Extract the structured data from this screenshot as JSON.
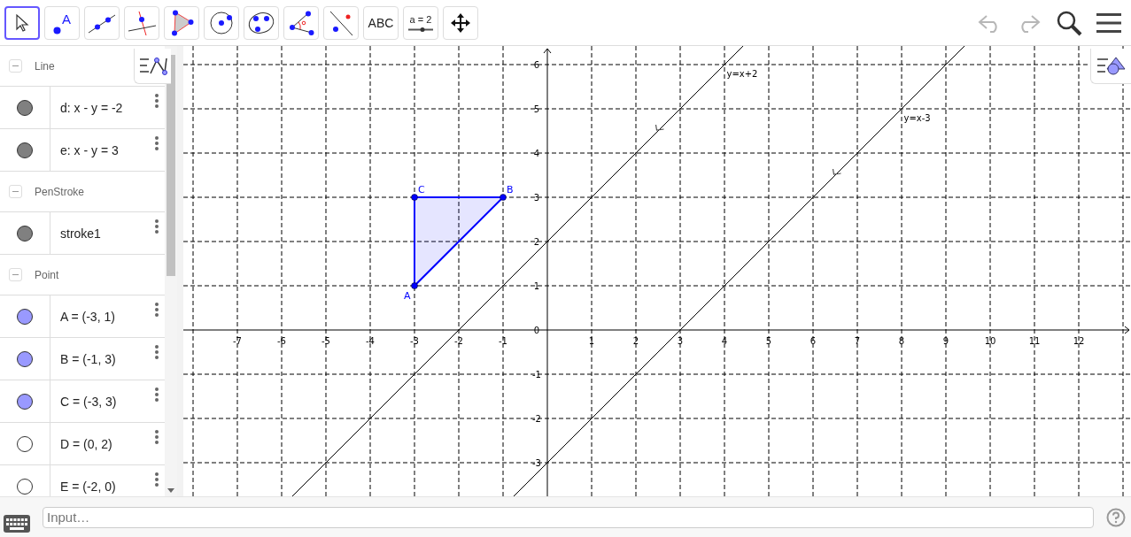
{
  "toolbar": {
    "tools": [
      {
        "kind": "move",
        "selected": true
      },
      {
        "kind": "point",
        "selected": false,
        "label": "A"
      },
      {
        "kind": "line",
        "selected": false
      },
      {
        "kind": "perpendicular",
        "selected": false
      },
      {
        "kind": "polygon",
        "selected": false
      },
      {
        "kind": "circle",
        "selected": false
      },
      {
        "kind": "conic",
        "selected": false
      },
      {
        "kind": "angle",
        "selected": false
      },
      {
        "kind": "reflect",
        "selected": false
      },
      {
        "kind": "text",
        "selected": false,
        "label": "ABC"
      },
      {
        "kind": "slider",
        "selected": false,
        "label": "a = 2"
      },
      {
        "kind": "pan",
        "selected": false
      }
    ],
    "actions": [
      {
        "kind": "undo",
        "disabled": true
      },
      {
        "kind": "redo",
        "disabled": true
      },
      {
        "kind": "search",
        "disabled": false
      },
      {
        "kind": "menu",
        "disabled": false
      }
    ]
  },
  "algebra": {
    "groups": [
      {
        "label": "Line",
        "expanded": true,
        "items": [
          {
            "text": "d: x - y = -2",
            "color": "#808080"
          },
          {
            "text": "e: x - y = 3",
            "color": "#808080"
          }
        ]
      },
      {
        "label": "PenStroke",
        "expanded": true,
        "items": [
          {
            "text": "stroke1",
            "color": "#808080"
          }
        ]
      },
      {
        "label": "Point",
        "expanded": true,
        "items": [
          {
            "text": "A = (-3, 1)",
            "color": "#9999ff"
          },
          {
            "text": "B = (-1, 3)",
            "color": "#9999ff"
          },
          {
            "text": "C = (-3, 3)",
            "color": "#9999ff"
          },
          {
            "text": "D = (0, 2)",
            "color": "#ffffff"
          },
          {
            "text": "E = (-2, 0)",
            "color": "#ffffff"
          }
        ]
      }
    ]
  },
  "graphics": {
    "chart_data": {
      "type": "line",
      "xlim": [
        -8.22,
        13.18
      ],
      "ylim": [
        -3.78,
        6.42
      ],
      "xticks": [
        -7,
        -6,
        -5,
        -4,
        -3,
        -2,
        -1,
        1,
        2,
        3,
        4,
        5,
        6,
        7,
        8,
        9,
        10,
        11,
        12
      ],
      "yticks": [
        -3,
        -2,
        -1,
        {
          "value": 0,
          "label": "0"
        },
        1,
        2,
        3,
        4,
        5,
        6
      ],
      "x": [
        -5.78,
        -3,
        -3,
        -1,
        -0.78,
        4.42,
        9.42
      ],
      "series": [
        {
          "name": "y=x+2",
          "color": "#000000",
          "values": [
            -3.78,
            null,
            null,
            null,
            1.22,
            6.42,
            null
          ]
        },
        {
          "name": "y=x-3",
          "color": "#000000",
          "values": [
            null,
            null,
            null,
            null,
            -3.78,
            1.42,
            6.42
          ]
        },
        {
          "name": "A",
          "color": "#0000ff",
          "marker": "circle",
          "values": [
            null,
            1,
            null,
            null,
            null,
            null,
            null
          ]
        },
        {
          "name": "C",
          "color": "#0000ff",
          "marker": "circle",
          "values": [
            null,
            null,
            3,
            null,
            null,
            null,
            null
          ]
        },
        {
          "name": "B",
          "color": "#0000ff",
          "marker": "circle",
          "values": [
            null,
            null,
            null,
            3,
            null,
            null,
            null
          ]
        }
      ]
    }
  },
  "input": {
    "placeholder": "Input…"
  }
}
